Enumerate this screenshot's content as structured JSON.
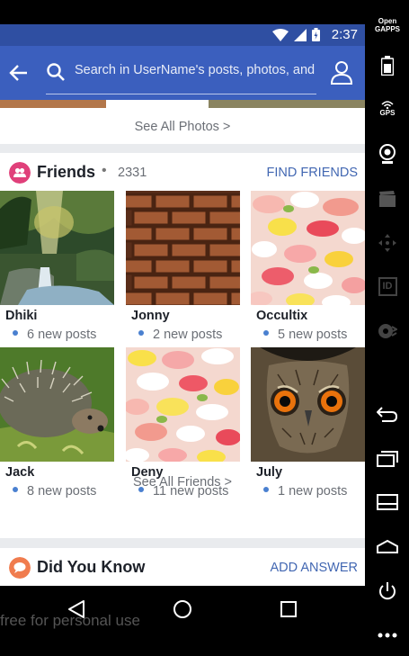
{
  "status_bar": {
    "time": "2:37"
  },
  "app_bar": {
    "search_placeholder": "Search in UserName's posts, photos, and"
  },
  "photos": {
    "see_all": "See All Photos >"
  },
  "friends": {
    "title": "Friends",
    "separator": "•",
    "count": "2331",
    "action": "FIND FRIENDS",
    "items": [
      {
        "name": "Dhiki",
        "posts": "6 new posts",
        "image": "waterfall-forest"
      },
      {
        "name": "Jonny",
        "posts": "2 new posts",
        "image": "brick-wall"
      },
      {
        "name": "Occultix",
        "posts": "5 new posts",
        "image": "flower-petals"
      },
      {
        "name": "Jack",
        "posts": "8 new posts",
        "image": "hedgehog"
      },
      {
        "name": "Deny",
        "posts": "11 new posts",
        "image": "flower-petals"
      },
      {
        "name": "July",
        "posts": "1 new posts",
        "image": "owl"
      }
    ],
    "see_all": "See All Friends >"
  },
  "did_you_know": {
    "title": "Did You Know",
    "action": "ADD ANSWER"
  },
  "watermark": "free for personal use",
  "emulator_toolbar": {
    "open_gapps": "Open\nGAPPS",
    "gps": "GPS",
    "id": "ID"
  },
  "colors": {
    "status_bar": "#2f4fa2",
    "app_bar": "#3b5fbe",
    "accent_blue": "#4267b2",
    "friends_badge": "#e0407a",
    "dyk_badge": "#f07c4e"
  }
}
